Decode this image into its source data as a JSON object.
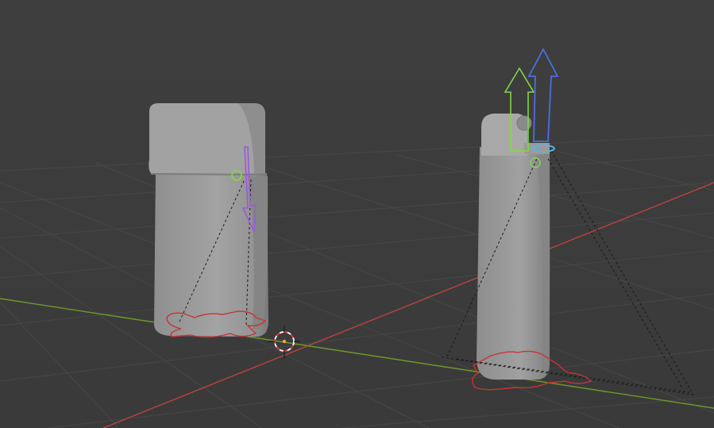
{
  "viewport": {
    "background": "#3c3c3c",
    "grid_color": "#4a4a4a",
    "x_axis_color": "#c0443f",
    "y_axis_color": "#6a9b2a"
  },
  "objects": [
    {
      "name": "lighter-left",
      "kind": "mesh",
      "color": "#9c9c9c"
    },
    {
      "name": "lighter-right",
      "kind": "mesh",
      "color": "#9c9c9c"
    }
  ],
  "gizmos": [
    {
      "name": "hook-arrow-purple",
      "color": "#9b59d6"
    },
    {
      "name": "hook-arrow-green",
      "color": "#7ed84a"
    },
    {
      "name": "hook-arrow-blue",
      "color": "#4a6fe0"
    }
  ],
  "cursor": {
    "name": "3d-cursor",
    "ring_a": "#d23b3b",
    "ring_b": "#f0f0f0"
  }
}
